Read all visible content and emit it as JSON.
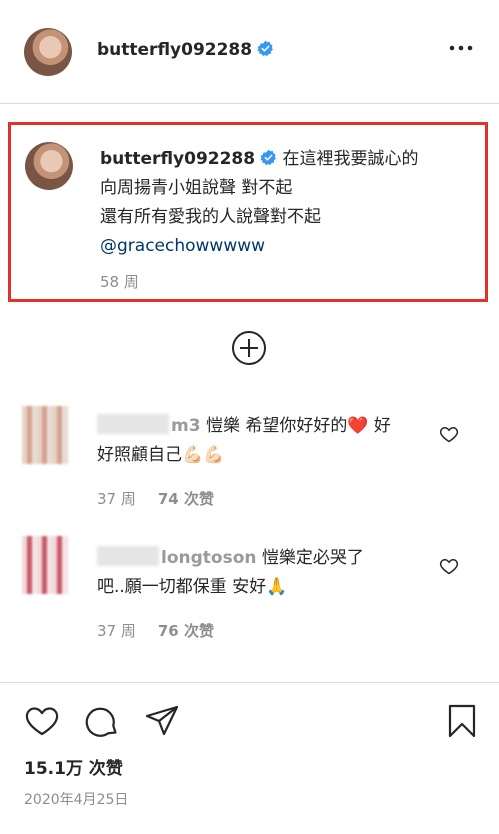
{
  "header": {
    "username": "butterfly092288",
    "avatar_icon": "profile-photo",
    "verified_icon": "verified-badge-icon",
    "more_icon": "more-options-icon"
  },
  "caption": {
    "username": "butterfly092288",
    "line1": "在這裡我要誠心的",
    "line2": "向周揚青小姐說聲 對不起",
    "line3": "還有所有愛我的人說聲對不起",
    "mention": "@gracechowwwww",
    "time": "58 周"
  },
  "load_more_icon": "plus-circle-icon",
  "comments": [
    {
      "username_visible": "m3",
      "text_line1": "愷樂 希望你好好的",
      "emoji1": "❤️",
      "text_line1_end": " 好",
      "text_line2": "好照顧自己",
      "emoji2": "💪🏻💪🏻",
      "time": "37 周",
      "likes": "74 次赞"
    },
    {
      "username_visible": "longtoson",
      "text_line1": "愷樂定必哭了",
      "text_line2": "吧..願一切都保重 安好",
      "emoji2": "🙏",
      "time": "37 周",
      "likes": "76 次赞"
    }
  ],
  "actions": {
    "like_icon": "heart-icon",
    "comment_icon": "comment-icon",
    "share_icon": "share-icon",
    "save_icon": "bookmark-icon",
    "likes_total": "15.1万 次赞",
    "date": "2020年4月25日"
  },
  "colors": {
    "accent_blue": "#3897f0",
    "highlight_red": "#e0312b",
    "heart_red": "#ed4956",
    "link": "#00376b"
  }
}
